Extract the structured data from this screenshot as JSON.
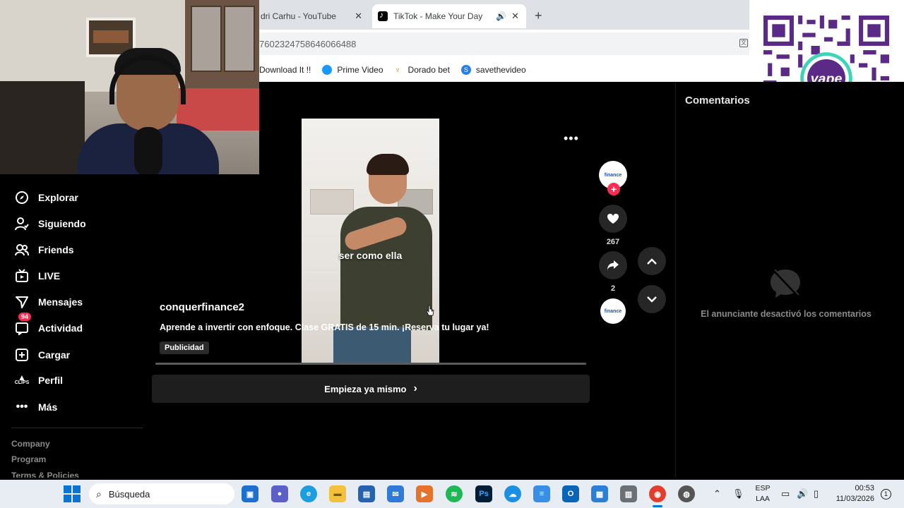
{
  "browser": {
    "tabs": [
      {
        "title": "dri Carhu - YouTube"
      },
      {
        "title": "TikTok - Make Your Day",
        "active": true
      }
    ],
    "url": "7602324758646066488",
    "bookmarks": [
      "Download It !!",
      "Prime Video",
      "Dorado bet",
      "savethevideo"
    ]
  },
  "sidebar": {
    "items": [
      {
        "label": "Explorar",
        "icon": "compass-icon"
      },
      {
        "label": "Siguiendo",
        "icon": "following-icon"
      },
      {
        "label": "Friends",
        "icon": "friends-icon"
      },
      {
        "label": "LIVE",
        "icon": "live-icon"
      },
      {
        "label": "Mensajes",
        "icon": "messages-icon"
      },
      {
        "label": "Actividad",
        "icon": "activity-icon",
        "badge": "94"
      },
      {
        "label": "Cargar",
        "icon": "upload-icon"
      },
      {
        "label": "Perfil",
        "icon": "profile-icon",
        "icon_text": "CLIPS"
      },
      {
        "label": "Más",
        "icon": "more-icon"
      }
    ],
    "footer": [
      "Company",
      "Program",
      "Terms & Policies"
    ]
  },
  "video": {
    "caption_overlay": "ser como ella",
    "author": "conquerfinance2",
    "description": "Aprende a invertir con enfoque. Clase GRATIS de 15 min. ¡Reserva tu lugar ya!",
    "badge": "Publicidad",
    "cta": "Empieza ya mismo",
    "avatar_text": "finance",
    "likes": "267",
    "shares": "2",
    "progress": 0.0
  },
  "comments": {
    "title": "Comentarios",
    "disabled_text": "El anunciante desactivó los comentarios"
  },
  "taskbar": {
    "search_placeholder": "Búsqueda",
    "lang_top": "ESP",
    "lang_bottom": "LAA",
    "time": "00:53",
    "date": "11/03/2026",
    "notifications": "1",
    "ps_label": "Ps"
  },
  "colors": {
    "accent": "#fe2c55",
    "background": "#000000",
    "qr_purple": "#5b2a86"
  }
}
